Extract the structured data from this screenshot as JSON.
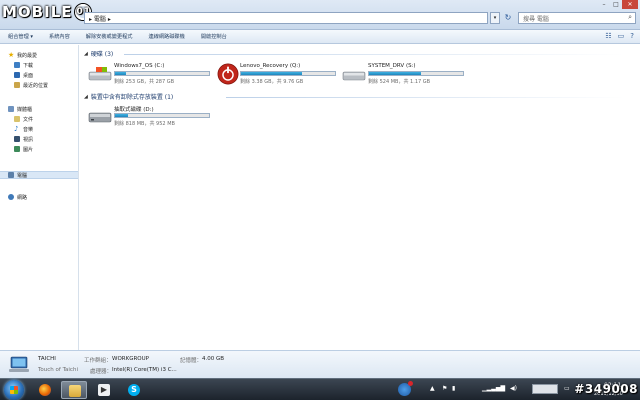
{
  "logo": {
    "text": "MOBILE",
    "glyph": "01"
  },
  "address": {
    "path": "▸ 電腦 ▸",
    "search_placeholder": "搜尋 電腦"
  },
  "commands": [
    {
      "label": "組合管理 ▾"
    },
    {
      "label": "系統內容"
    },
    {
      "label": "解除安裝或變更程式"
    },
    {
      "label": "連線網路磁碟機"
    },
    {
      "label": "開啟控制台"
    }
  ],
  "nav": {
    "favorites": "我的最愛",
    "favorites_items": [
      "下載",
      "桌面",
      "最近的位置"
    ],
    "libraries": "媒體櫃",
    "libraries_items": [
      "文件",
      "音樂",
      "視訊",
      "圖片"
    ],
    "computer": "電腦",
    "network": "網路"
  },
  "sections": [
    {
      "title": "硬碟 (3)"
    },
    {
      "title": "裝置中含有卸除式存放裝置 (1)"
    }
  ],
  "drives": [
    {
      "name": "Windows7_OS (C:)",
      "free": "剩餘 253 GB，共 287 GB",
      "used_fraction": 0.12,
      "color": "blue"
    },
    {
      "name": "Lenovo_Recovery (Q:)",
      "free": "剩餘 3.38 GB，共 9.76 GB",
      "used_fraction": 0.65,
      "color": "blue"
    },
    {
      "name": "SYSTEM_DRV (S:)",
      "free": "剩餘 524 MB，共 1.17 GB",
      "used_fraction": 0.55,
      "color": "blue"
    },
    {
      "name": "抽取式磁碟 (D:)",
      "free": "剩餘 818 MB，共 952 MB",
      "used_fraction": 0.14,
      "color": "blue"
    }
  ],
  "details": {
    "computer_name": "TAICHI",
    "subtitle": "Touch of Taichi",
    "workgroup_label": "工作群組：",
    "workgroup_value": "WORKGROUP",
    "memory_label": "記憶體：",
    "memory_value": "4.00 GB",
    "processor_label": "處理器：",
    "processor_value": "Intel(R) Core(TM) i3 C..."
  },
  "tray": {
    "clock_time": "02:11",
    "clock_date": "2011/12/30"
  },
  "watermark": "#349008",
  "colors": {
    "accent": "#1f86bd",
    "titlebar": "#dfe9f5",
    "taskbar": "#1c232c"
  }
}
